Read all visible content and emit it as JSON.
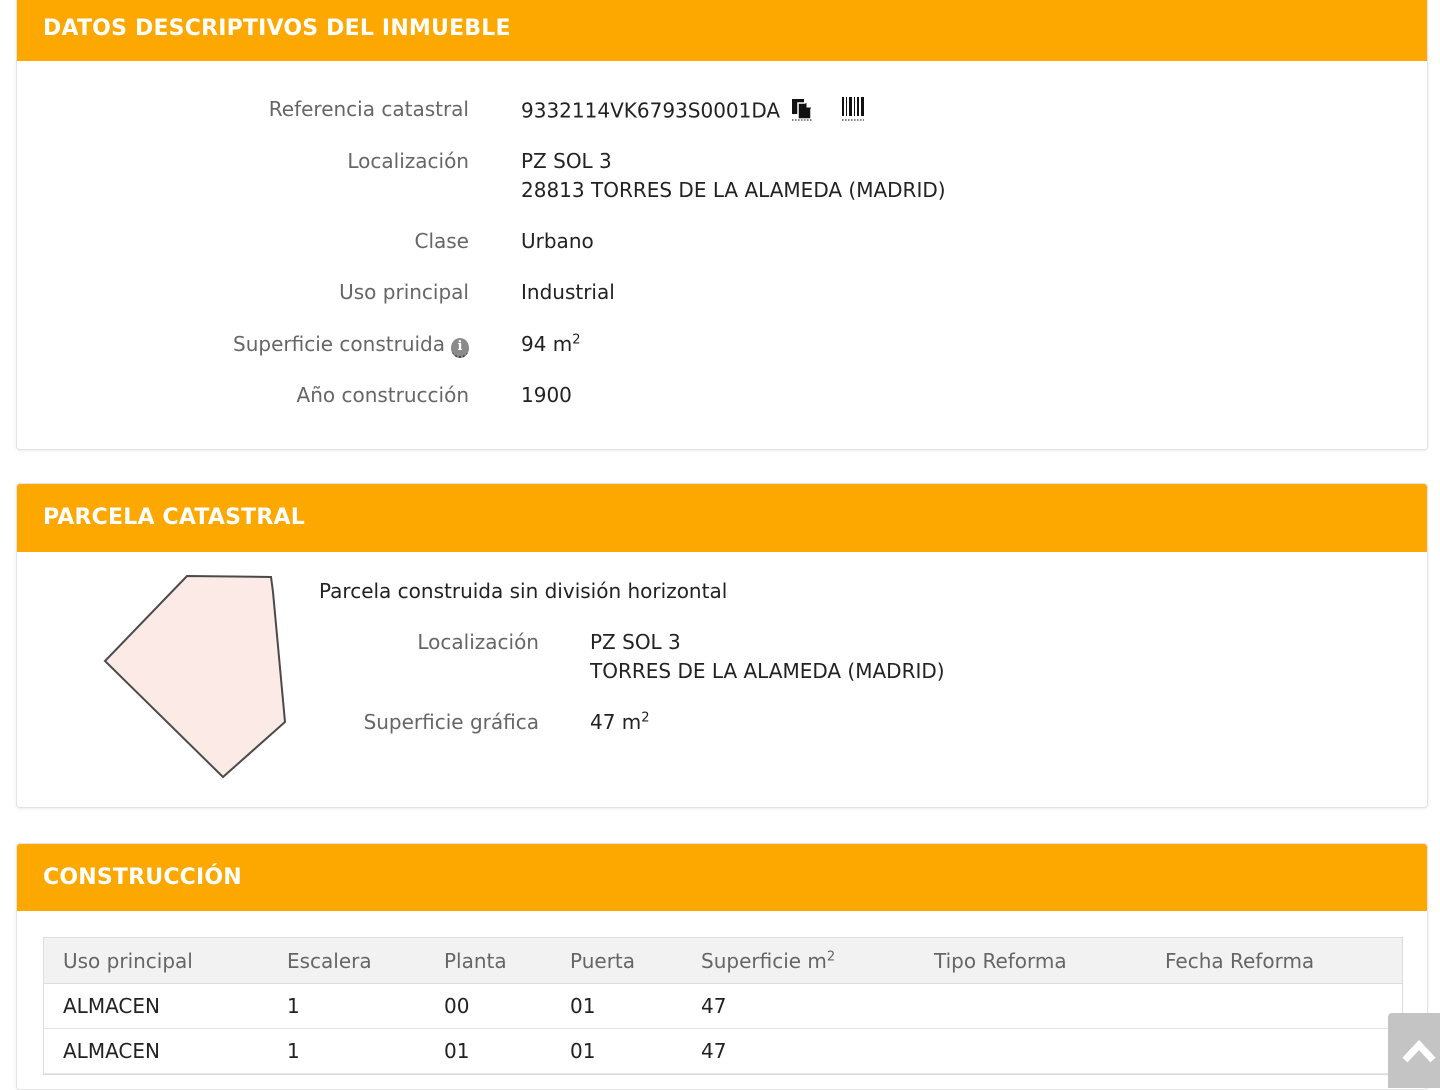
{
  "inmueble": {
    "title": "DATOS DESCRIPTIVOS DEL INMUEBLE",
    "referencia_label": "Referencia catastral",
    "referencia_value": "9332114VK6793S0001DA",
    "localizacion_label": "Localización",
    "localizacion_line1": "PZ SOL 3",
    "localizacion_line2": "28813 TORRES DE LA ALAMEDA (MADRID)",
    "clase_label": "Clase",
    "clase_value": "Urbano",
    "uso_label": "Uso principal",
    "uso_value": "Industrial",
    "superficie_label": "Superficie construida",
    "superficie_value": "94 m",
    "superficie_sup": "2",
    "anio_label": "Año construcción",
    "anio_value": "1900"
  },
  "parcela": {
    "title": "PARCELA CATASTRAL",
    "subtitle": "Parcela construida sin división horizontal",
    "localizacion_label": "Localización",
    "localizacion_line1": "PZ SOL 3",
    "localizacion_line2": "TORRES DE LA ALAMEDA (MADRID)",
    "superficie_label": "Superficie gráfica",
    "superficie_value": "47 m",
    "superficie_sup": "2"
  },
  "construccion": {
    "title": "CONSTRUCCIÓN",
    "headers": [
      "Uso principal",
      "Escalera",
      "Planta",
      "Puerta",
      "Superficie m",
      "Tipo Reforma",
      "Fecha Reforma"
    ],
    "superficie_header_sup": "2",
    "rows": [
      [
        "ALMACEN",
        "1",
        "00",
        "01",
        "47",
        "",
        ""
      ],
      [
        "ALMACEN",
        "1",
        "01",
        "01",
        "47",
        "",
        ""
      ]
    ]
  },
  "icons": {
    "copy": "copy-icon",
    "barcode": "barcode-icon",
    "info": "info-icon",
    "scroll_top": "chevron-up-icon"
  },
  "colors": {
    "header_bg": "#fda800",
    "parcel_fill": "#fbeae6",
    "parcel_stroke": "#4a4a4a"
  }
}
